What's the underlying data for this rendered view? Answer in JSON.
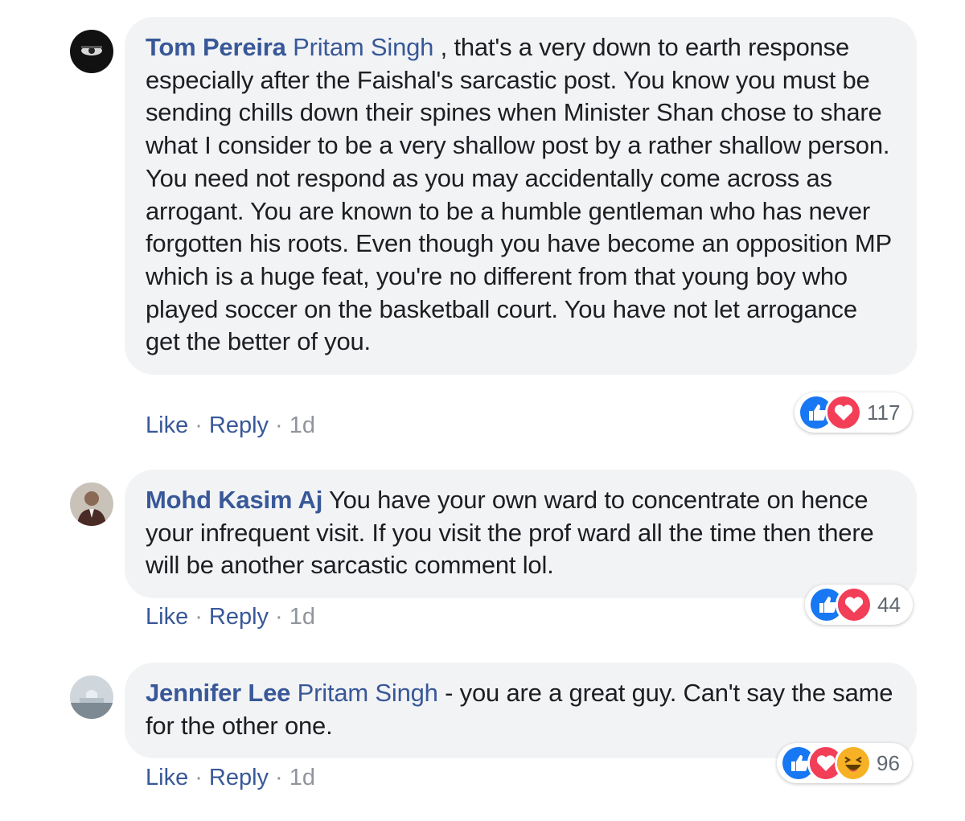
{
  "comments": [
    {
      "author": "Tom Pereira",
      "mention": "Pritam Singh",
      "text": " , that's a very down to earth response especially after the Faishal's sarcastic post. You know you must be sending chills down their spines when Minister Shan chose to share what I consider to be a very shallow post by a rather shallow person. You need not respond as you may accidentally come across as arrogant. You are known to be a humble gentleman who has never forgotten his roots. Even though you have become an opposition MP which is a huge feat, you're no different from that young boy who played soccer on the basketball court. You have not let arrogance get the better of you.",
      "like_label": "Like",
      "reply_label": "Reply",
      "time": "1d",
      "reaction_icons": [
        "like-icon",
        "love-icon"
      ],
      "reaction_count": "117"
    },
    {
      "author": "Mohd Kasim Aj",
      "mention": "",
      "text": " You have your own ward to concentrate on hence your infrequent visit. If you visit the prof ward all the time then there will be another sarcastic comment lol.",
      "like_label": "Like",
      "reply_label": "Reply",
      "time": "1d",
      "reaction_icons": [
        "like-icon",
        "love-icon"
      ],
      "reaction_count": "44"
    },
    {
      "author": "Jennifer Lee",
      "mention": "Pritam Singh",
      "text": " - you are a great guy. Can't say the same for the other one.",
      "like_label": "Like",
      "reply_label": "Reply",
      "time": "1d",
      "reaction_icons": [
        "like-icon",
        "love-icon",
        "haha-icon"
      ],
      "reaction_count": "96"
    }
  ],
  "separator": "·",
  "colors": {
    "author": "#385898",
    "bubble": "#f2f3f5",
    "like": "#1877f2",
    "love": "#f33e58",
    "haha": "#f7b125"
  }
}
